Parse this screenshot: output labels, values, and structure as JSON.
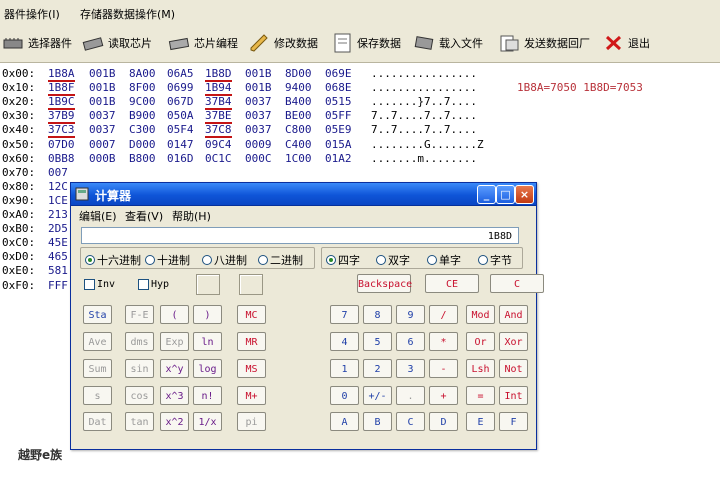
{
  "menu": [
    "器件操作(I)",
    "存储器数据操作(M)"
  ],
  "toolbar": [
    {
      "label": "选择器件",
      "icon": "chip-icon"
    },
    {
      "label": "读取芯片",
      "icon": "read-chip-icon"
    },
    {
      "label": "芯片编程",
      "icon": "program-chip-icon"
    },
    {
      "label": "修改数据",
      "icon": "pencil-icon"
    },
    {
      "label": "保存数据",
      "icon": "save-icon"
    },
    {
      "label": "载入文件",
      "icon": "load-file-icon"
    },
    {
      "label": "发送数据回厂",
      "icon": "send-icon"
    },
    {
      "label": "退出",
      "icon": "exit-icon"
    }
  ],
  "hex_rows": [
    {
      "addr": "0x00:",
      "words": [
        "1B8A",
        "001B",
        "8A00",
        "06A5",
        "1B8D",
        "001B",
        "8D00",
        "069E"
      ],
      "ascii": "................"
    },
    {
      "addr": "0x10:",
      "words": [
        "1B8F",
        "001B",
        "8F00",
        "0699",
        "1B94",
        "001B",
        "9400",
        "068E"
      ],
      "ascii": "................"
    },
    {
      "addr": "0x20:",
      "words": [
        "1B9C",
        "001B",
        "9C00",
        "067D",
        "37B4",
        "0037",
        "B400",
        "0515"
      ],
      "ascii": ".......}7..7...."
    },
    {
      "addr": "0x30:",
      "words": [
        "37B9",
        "0037",
        "B900",
        "050A",
        "37BE",
        "0037",
        "BE00",
        "05FF"
      ],
      "ascii": "7..7....7..7...."
    },
    {
      "addr": "0x40:",
      "words": [
        "37C3",
        "0037",
        "C300",
        "05F4",
        "37C8",
        "0037",
        "C800",
        "05E9"
      ],
      "ascii": "7..7....7..7...."
    },
    {
      "addr": "0x50:",
      "words": [
        "07D0",
        "0007",
        "D000",
        "0147",
        "09C4",
        "0009",
        "C400",
        "015A"
      ],
      "ascii": "........G.......Z"
    },
    {
      "addr": "0x60:",
      "words": [
        "0BB8",
        "000B",
        "B800",
        "016D",
        "0C1C",
        "000C",
        "1C00",
        "01A2"
      ],
      "ascii": ".......m........"
    },
    {
      "addr": "0x70:",
      "words": [
        "007"
      ],
      "ascii": ""
    },
    {
      "addr": "0x80:",
      "words": [
        "12C"
      ],
      "ascii": ""
    },
    {
      "addr": "0x90:",
      "words": [
        "1CE"
      ],
      "ascii": ""
    },
    {
      "addr": "0xA0:",
      "words": [
        "213"
      ],
      "ascii": ""
    },
    {
      "addr": "0xB0:",
      "words": [
        "2D5"
      ],
      "ascii": ""
    },
    {
      "addr": "0xC0:",
      "words": [
        "45E"
      ],
      "ascii": ""
    },
    {
      "addr": "0xD0:",
      "words": [
        "465"
      ],
      "ascii": ""
    },
    {
      "addr": "0xE0:",
      "words": [
        "581"
      ],
      "ascii": ""
    },
    {
      "addr": "0xF0:",
      "words": [
        "FFF"
      ],
      "ascii": ""
    }
  ],
  "note": "1B8A=7050  1B8D=7053",
  "calc": {
    "title": "计算器",
    "menu": [
      "编辑(E)",
      "查看(V)",
      "帮助(H)"
    ],
    "display": "1B8D",
    "bases": [
      "十六进制",
      "十进制",
      "八进制",
      "二进制"
    ],
    "word_sizes": [
      "四字",
      "双字",
      "单字",
      "字节"
    ],
    "checks": [
      "Inv",
      "Hyp"
    ],
    "keys": {
      "backspace": "Backspace",
      "ce": "CE",
      "c": "C",
      "sta": "Sta",
      "fe": "F-E",
      "lparen": "(",
      "rparen": ")",
      "mc": "MC",
      "ave": "Ave",
      "dms": "dms",
      "exp": "Exp",
      "ln": "ln",
      "mr": "MR",
      "sum": "Sum",
      "sin": "sin",
      "xy": "x^y",
      "log": "log",
      "ms": "MS",
      "s": "s",
      "cos": "cos",
      "x3": "x^3",
      "nfact": "n!",
      "mplus": "M+",
      "dat": "Dat",
      "tan": "tan",
      "x2": "x^2",
      "inv": "1/x",
      "pi": "pi",
      "n7": "7",
      "n8": "8",
      "n9": "9",
      "div": "/",
      "mod": "Mod",
      "and": "And",
      "n4": "4",
      "n5": "5",
      "n6": "6",
      "mul": "*",
      "or": "Or",
      "xor": "Xor",
      "n1": "1",
      "n2": "2",
      "n3": "3",
      "minus": "-",
      "lsh": "Lsh",
      "not": "Not",
      "n0": "0",
      "pm": "+/-",
      "dot": ".",
      "plus": "+",
      "eq": "=",
      "int": "Int",
      "A": "A",
      "B": "B",
      "C2": "C",
      "D": "D",
      "E": "E",
      "F": "F"
    }
  },
  "footer": "越野e族"
}
